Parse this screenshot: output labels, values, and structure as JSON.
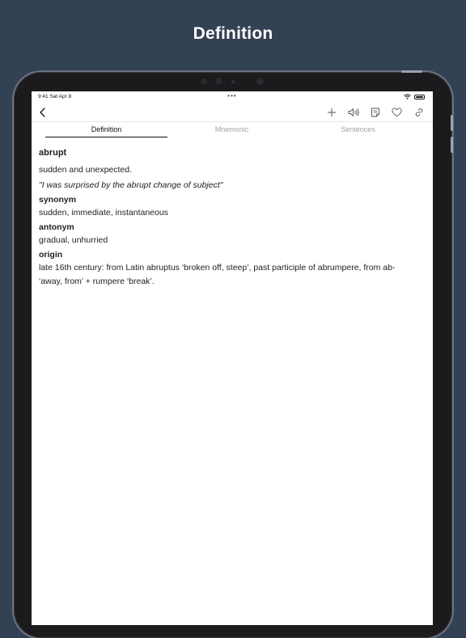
{
  "hero": {
    "title": "Definition"
  },
  "status": {
    "time": "9:41  Sat Apr 8",
    "dots": "•••"
  },
  "nav": {
    "back_icon": "chevron-left-icon",
    "actions": [
      "plus-icon",
      "speaker-icon",
      "note-icon",
      "heart-icon",
      "link-icon"
    ]
  },
  "tabs": [
    {
      "label": "Definition",
      "active": true
    },
    {
      "label": "Mnemonic",
      "active": false
    },
    {
      "label": "Sentences",
      "active": false
    }
  ],
  "entry": {
    "word": "abrupt",
    "definition": "sudden and unexpected.",
    "example": "\"I was surprised by the abrupt change of subject\"",
    "synonym_heading": "synonym",
    "synonyms": "sudden, immediate, instantaneous",
    "antonym_heading": "antonym",
    "antonyms": "gradual, unhurried",
    "origin_heading": "origin",
    "origin": "late 16th century: from Latin abruptus ‘broken off, steep’, past participle of abrumpere, from ab- ‘away, from’ + rumpere ‘break’."
  },
  "colors": {
    "background": "#334155",
    "screen": "#ffffff",
    "text": "#222222",
    "inactive_tab": "#a3a3a3"
  }
}
